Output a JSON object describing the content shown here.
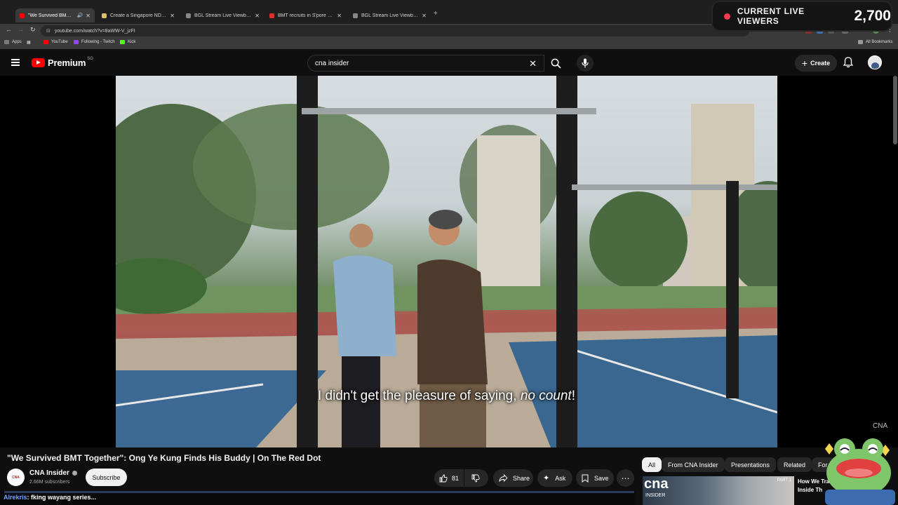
{
  "browser": {
    "tabs": [
      {
        "title": "\"We Survived BMT Togethe",
        "favicon_color": "#ff0000",
        "active": true,
        "audio": true
      },
      {
        "title": "Create a Singapore NDP Song",
        "favicon_color": "#d8c070",
        "active": false
      },
      {
        "title": "BGL Stream Live Viewbots",
        "favicon_color": "#888888",
        "active": false
      },
      {
        "title": "BMT recruits in S'pore given m",
        "favicon_color": "#d9302b",
        "active": false
      },
      {
        "title": "BGL Stream Live Viewbots",
        "favicon_color": "#888888",
        "active": false
      }
    ],
    "new_tab": "+",
    "url": "youtube.com/watch?v=8aWW-V_jzFI",
    "bookmarks": [
      {
        "label": "Apps",
        "color": "#7a7a7a"
      },
      {
        "label": "YouTube",
        "color": "#ff0000"
      },
      {
        "label": "Following - Twitch",
        "color": "#9147ff"
      },
      {
        "label": "Kick",
        "color": "#53fc18"
      }
    ],
    "all_bookmarks": "All Bookmarks"
  },
  "overlay": {
    "viewers_label": "CURRENT LIVE VIEWERS",
    "viewers_count": "2,700",
    "dot_color": "#f23b4e"
  },
  "youtube": {
    "logo_text": "Premium",
    "country_code": "SG",
    "search_value": "cna insider",
    "create_label": "Create",
    "icons": {
      "menu": "hamburger-icon",
      "clear": "close-icon",
      "search": "search-icon",
      "mic": "microphone-icon",
      "bell": "bell-icon"
    }
  },
  "video": {
    "subtitle_plain": "I didn't get the pleasure of saying, ",
    "subtitle_italic": "no count",
    "subtitle_end": "!",
    "watermark": "CNA"
  },
  "watch": {
    "title": "\"We Survived BMT Together\": Ong Ye Kung Finds His Buddy | On The Red Dot",
    "channel_avatar": "CNA",
    "channel": "CNA Insider",
    "subscribers": "2.66M subscribers",
    "subscribe_label": "Subscribe",
    "likes": "81",
    "share_label": "Share",
    "ask_label": "Ask",
    "save_label": "Save",
    "more": "⋯"
  },
  "related": {
    "chips": [
      "All",
      "From CNA Insider",
      "Presentations",
      "Related",
      "For"
    ],
    "thumb_brand": "cna",
    "thumb_sub": "INSIDER",
    "thumb_part": "PART 1",
    "first_title": "How We Trai Inside Th"
  },
  "chat": {
    "user": "Alrekris",
    "message": ": fking wayang series..."
  }
}
